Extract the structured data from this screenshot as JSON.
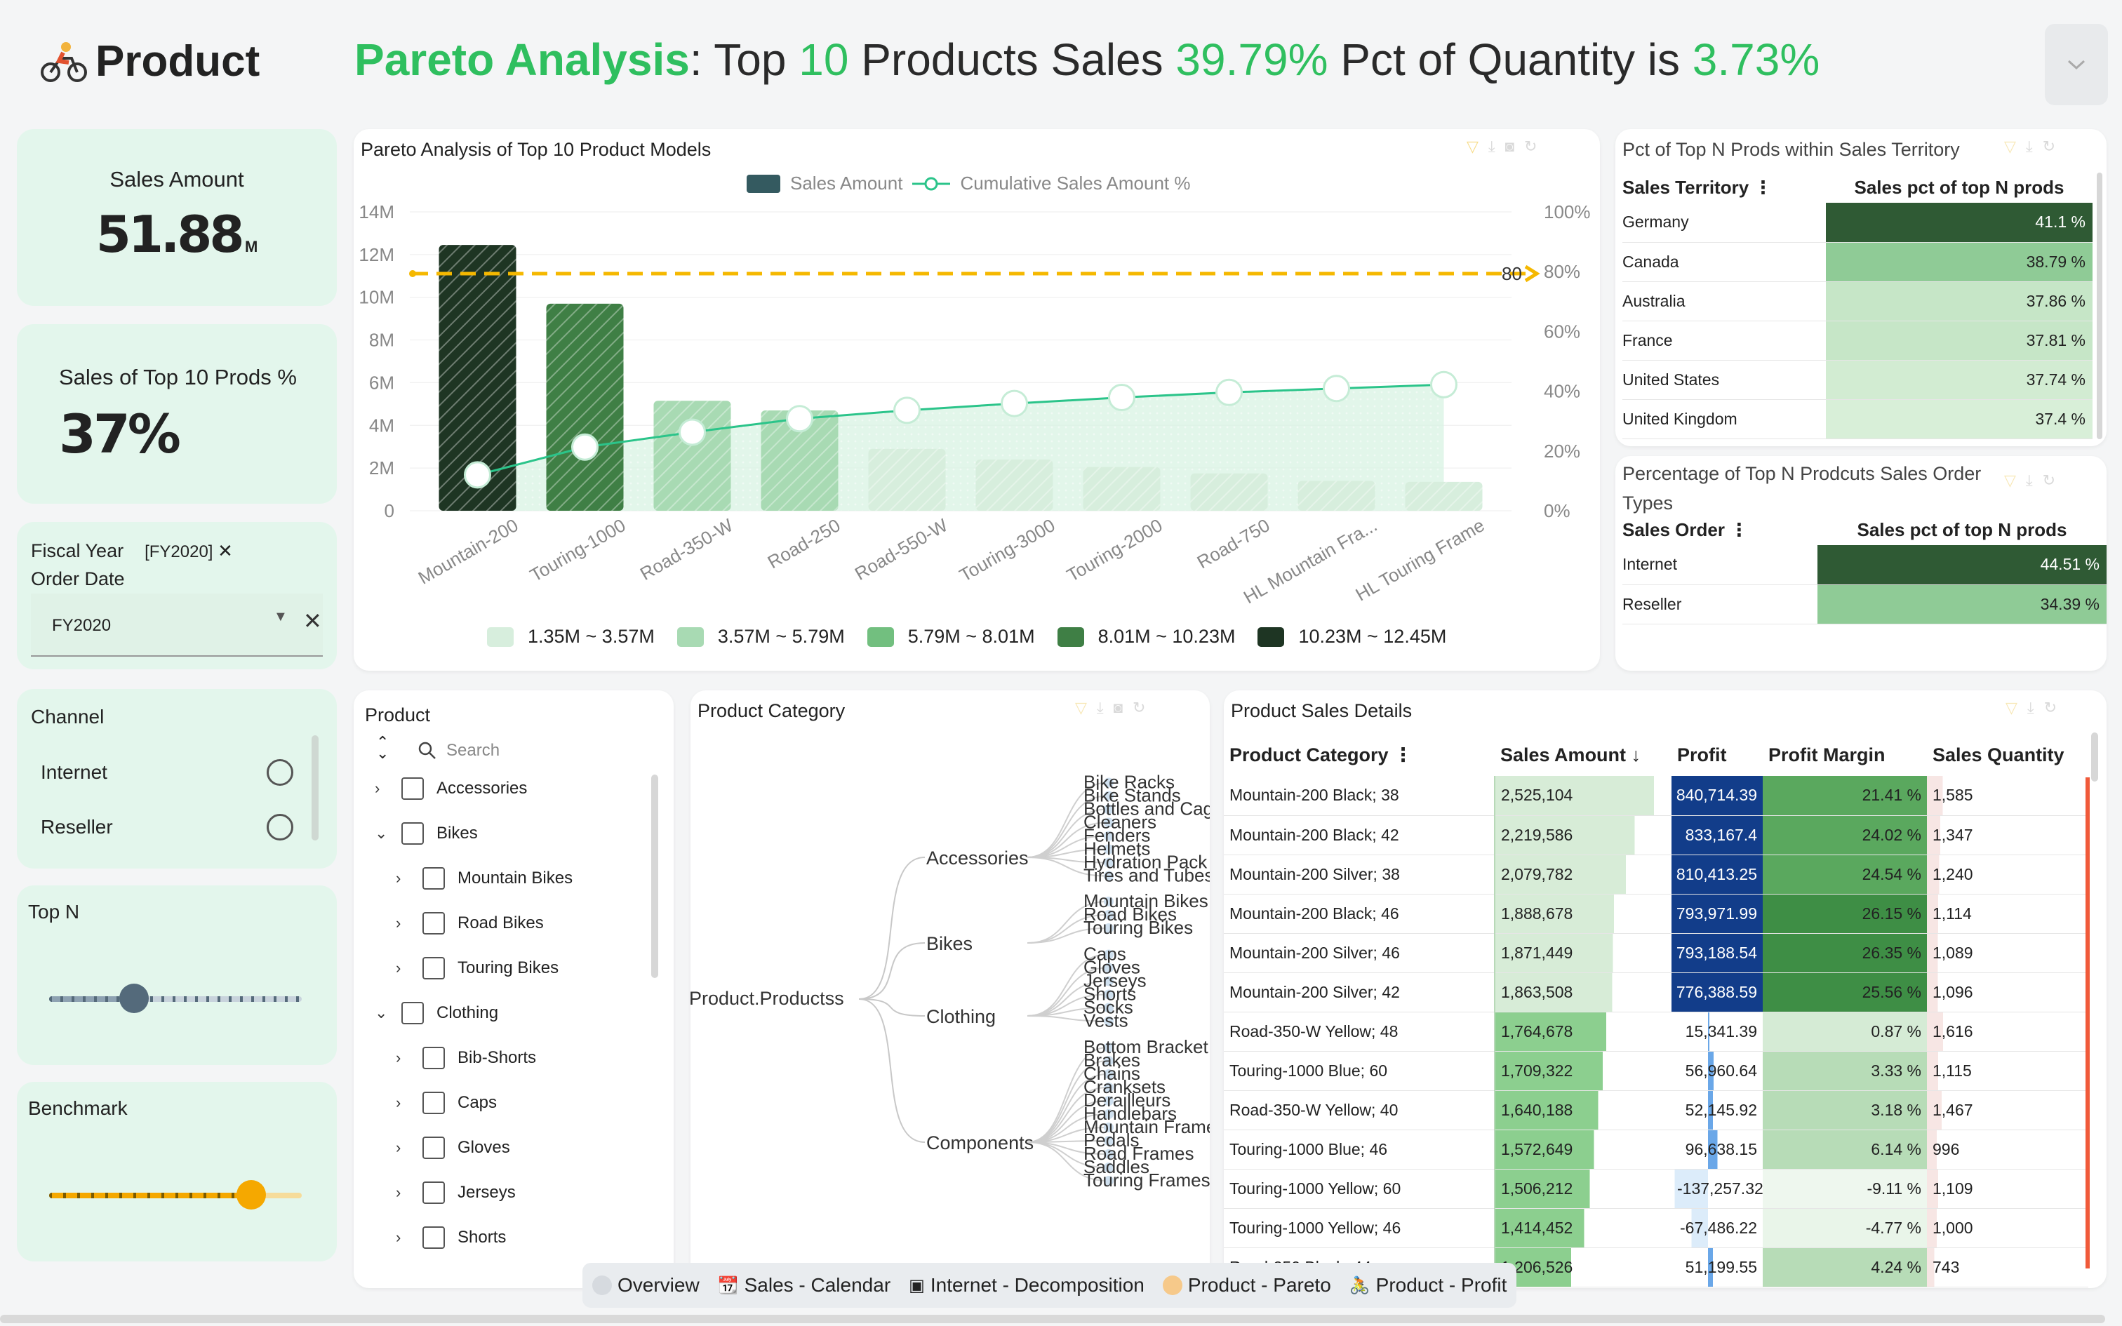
{
  "header": {
    "logo_text": "Product",
    "title_parts": [
      "Pareto Analysis",
      ": Top ",
      "10",
      " Products Sales ",
      "39.79%",
      " Pct of Quantity is ",
      "3.73%"
    ],
    "menu_icon": "chevron-down-icon"
  },
  "kpi": {
    "sales_label": "Sales Amount",
    "sales_value": "51.88",
    "sales_unit": "M",
    "top_label": "Sales of Top 10 Prods %",
    "top_value": "37%"
  },
  "filters": {
    "fiscal_year_label": "Fiscal Year",
    "fiscal_year_chip": "[FY2020]",
    "order_date_label": "Order Date",
    "select_value": "FY2020",
    "channel_label": "Channel",
    "channels": [
      "Internet",
      "Reseller"
    ],
    "topn_label": "Top N",
    "topn_level": 0.33,
    "benchmark_label": "Benchmark",
    "benchmark_level": 0.8
  },
  "pareto": {
    "title": "Pareto Analysis of Top 10 Product Models",
    "legend_bar": "Sales Amount",
    "legend_line": "Cumulative Sales Amount %",
    "benchmark_label": "80",
    "range_legend": [
      "1.35M ~ 3.57M",
      "3.57M ~ 5.79M",
      "5.79M ~ 8.01M",
      "8.01M ~ 10.23M",
      "10.23M ~ 12.45M"
    ],
    "range_colors": [
      "#d7eedd",
      "#a8dab3",
      "#72bf7f",
      "#3f7f45",
      "#1e3523"
    ]
  },
  "chart_data": {
    "type": "bar",
    "title": "Pareto Analysis of Top 10 Product Models",
    "categories": [
      "Mountain-200",
      "Touring-1000",
      "Road-350-W",
      "Road-250",
      "Road-550-W",
      "Touring-3000",
      "Touring-2000",
      "Road-750",
      "HL Mountain Fra...",
      "HL Touring Frame"
    ],
    "y_ticks": [
      "0",
      "2M",
      "4M",
      "6M",
      "8M",
      "10M",
      "12M",
      "14M"
    ],
    "y2_ticks": [
      "0%",
      "20%",
      "40%",
      "60%",
      "80%",
      "100%"
    ],
    "ylim": [
      0,
      14000000
    ],
    "y2lim": [
      0,
      100
    ],
    "series": [
      {
        "name": "Sales Amount",
        "type": "bar",
        "values": [
          12450000,
          9700000,
          5150000,
          4700000,
          2900000,
          2400000,
          2050000,
          1750000,
          1400000,
          1350000
        ]
      },
      {
        "name": "Cumulative Sales Amount %",
        "type": "line",
        "values": [
          12.0,
          21.3,
          26.3,
          30.8,
          33.6,
          35.9,
          37.9,
          39.6,
          40.9,
          42.2
        ]
      }
    ],
    "benchmark": 80
  },
  "territory": {
    "title": "Pct of Top N Prods within Sales Territory",
    "col1": "Sales Territory",
    "col2": "Sales pct of top N prods",
    "rows": [
      {
        "name": "Germany",
        "value": "41.1 %",
        "color": "#2f5a34"
      },
      {
        "name": "Canada",
        "value": "38.79 %",
        "color": "#8fcb96"
      },
      {
        "name": "Australia",
        "value": "37.86 %",
        "color": "#c6e6c7"
      },
      {
        "name": "France",
        "value": "37.81 %",
        "color": "#c6e6c7"
      },
      {
        "name": "United States",
        "value": "37.74 %",
        "color": "#d2ecd2"
      },
      {
        "name": "United Kingdom",
        "value": "37.4 %",
        "color": "#d8efd8"
      }
    ]
  },
  "order_types": {
    "title_1": "Percentage of Top N Prodcuts Sales Order",
    "title_2": "Types",
    "col1": "Sales Order",
    "col2": "Sales pct of top N prods",
    "rows": [
      {
        "name": "Internet",
        "value": "44.51 %",
        "color": "#2f5a34"
      },
      {
        "name": "Reseller",
        "value": "34.39 %",
        "color": "#8fcb96"
      }
    ]
  },
  "product_tree": {
    "title": "Product",
    "search_placeholder": "Search",
    "items": [
      {
        "label": "Accessories",
        "level": 0,
        "expanded": false
      },
      {
        "label": "Bikes",
        "level": 0,
        "expanded": true
      },
      {
        "label": "Mountain Bikes",
        "level": 1,
        "expanded": false
      },
      {
        "label": "Road Bikes",
        "level": 1,
        "expanded": false
      },
      {
        "label": "Touring Bikes",
        "level": 1,
        "expanded": false
      },
      {
        "label": "Clothing",
        "level": 0,
        "expanded": true
      },
      {
        "label": "Bib-Shorts",
        "level": 1,
        "expanded": false
      },
      {
        "label": "Caps",
        "level": 1,
        "expanded": false
      },
      {
        "label": "Gloves",
        "level": 1,
        "expanded": false
      },
      {
        "label": "Jerseys",
        "level": 1,
        "expanded": false
      },
      {
        "label": "Shorts",
        "level": 1,
        "expanded": false
      }
    ]
  },
  "category_tree": {
    "title": "Product Category",
    "root": "Product.Productss",
    "groups": [
      {
        "name": "Accessories",
        "children": [
          "Bike Racks",
          "Bike Stands",
          "Bottles and Cage",
          "Cleaners",
          "Fenders",
          "Helmets",
          "Hydration Pack",
          "Tires and Tubes"
        ]
      },
      {
        "name": "Bikes",
        "children": [
          "Mountain Bikes",
          "Road Bikes",
          "Touring Bikes"
        ]
      },
      {
        "name": "Clothing",
        "children": [
          "Caps",
          "Gloves",
          "Jerseys",
          "Shorts",
          "Socks",
          "Vests"
        ]
      },
      {
        "name": "Components",
        "children": [
          "Bottom Bracket",
          "Brakes",
          "Chains",
          "Cranksets",
          "Derailleurs",
          "Handlebars",
          "Mountain Frame",
          "Pedals",
          "Road Frames",
          "Saddles",
          "Touring Frames"
        ]
      }
    ]
  },
  "details": {
    "title": "Product Sales Details",
    "headers": [
      "Product Category",
      "Sales Amount",
      "Profit",
      "Profit Margin",
      "Sales Quantity"
    ],
    "rows": [
      [
        "Mountain-200 Black; 38",
        "2,525,104",
        "840,714.39",
        "21.41 %",
        "1,585"
      ],
      [
        "Mountain-200 Black; 42",
        "2,219,586",
        "833,167.4",
        "24.02 %",
        "1,347"
      ],
      [
        "Mountain-200 Silver; 38",
        "2,079,782",
        "810,413.25",
        "24.54 %",
        "1,240"
      ],
      [
        "Mountain-200 Black; 46",
        "1,888,678",
        "793,971.99",
        "26.15 %",
        "1,114"
      ],
      [
        "Mountain-200 Silver; 46",
        "1,871,449",
        "793,188.54",
        "26.35 %",
        "1,089"
      ],
      [
        "Mountain-200 Silver; 42",
        "1,863,508",
        "776,388.59",
        "25.56 %",
        "1,096"
      ],
      [
        "Road-350-W Yellow; 48",
        "1,764,678",
        "15,341.39",
        "0.87 %",
        "1,616"
      ],
      [
        "Touring-1000 Blue; 60",
        "1,709,322",
        "56,960.64",
        "3.33 %",
        "1,115"
      ],
      [
        "Road-350-W Yellow; 40",
        "1,640,188",
        "52,145.92",
        "3.18 %",
        "1,467"
      ],
      [
        "Touring-1000 Blue; 46",
        "1,572,649",
        "96,638.15",
        "6.14 %",
        "996"
      ],
      [
        "Touring-1000 Yellow; 60",
        "1,506,212",
        "-137,257.32",
        "-9.11 %",
        "1,109"
      ],
      [
        "Touring-1000 Yellow; 46",
        "1,414,452",
        "-67,486.22",
        "-4.77 %",
        "1,000"
      ],
      [
        "Road-250 Black; 44",
        "1,206,526",
        "51,199.55",
        "4.24 %",
        "743"
      ]
    ]
  },
  "tabs": [
    {
      "label": "Overview",
      "icon": "circle-icon"
    },
    {
      "label": "Sales - Calendar",
      "icon": "calendar-icon"
    },
    {
      "label": "Internet - Decomposition",
      "icon": "monitor-icon"
    },
    {
      "label": "Product - Pareto",
      "icon": "bike-icon"
    },
    {
      "label": "Product - Profit",
      "icon": "bike-icon"
    }
  ]
}
